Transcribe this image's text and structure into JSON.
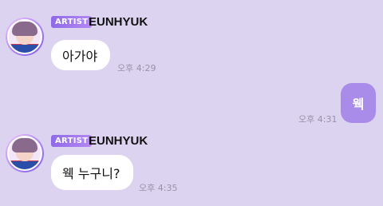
{
  "messages": [
    {
      "badge": "ARTIST",
      "sender": "EUNHYUK",
      "text": "아가야",
      "time": "오후 4:29",
      "avatar_icon": "artist-avatar"
    },
    {
      "text": "웩",
      "time": "오후 4:31",
      "own": true
    },
    {
      "badge": "ARTIST",
      "sender": "EUNHYUK",
      "text": "웩 누구니?",
      "time": "오후 4:35",
      "avatar_icon": "artist-avatar"
    }
  ],
  "colors": {
    "background": "#dcd3f0",
    "own_bubble": "#a98be9",
    "badge": "#9b74ee"
  }
}
